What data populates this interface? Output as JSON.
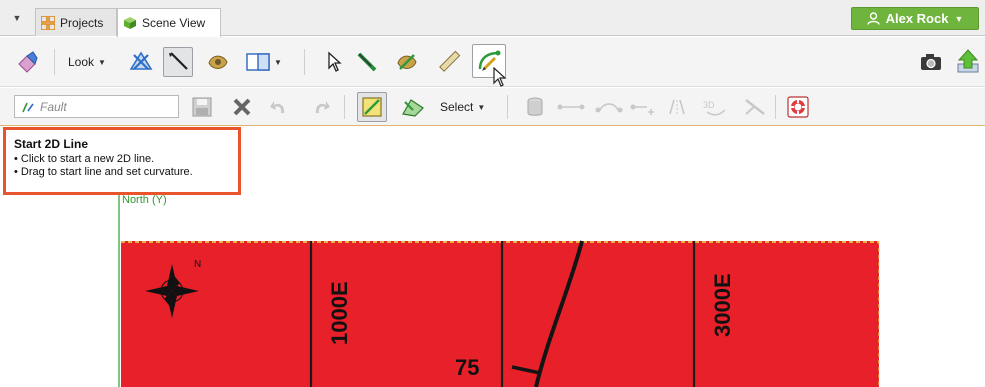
{
  "tabs": {
    "projects_label": "Projects",
    "scene_label": "Scene View"
  },
  "user": {
    "name": "Alex Rock"
  },
  "toolbar": {
    "look_label": "Look",
    "select_label": "Select"
  },
  "object_name_field": {
    "placeholder": "Fault"
  },
  "tooltip": {
    "title": "Start 2D Line",
    "lines": [
      "• Click to start a new 2D line.",
      "• Drag to start line and set curvature."
    ]
  },
  "scene": {
    "axis_label": "North (Y)",
    "map_labels": {
      "easting_1": "1000E",
      "easting_2": "3000E",
      "dip_value": "75",
      "compass_letter": "N"
    },
    "colors": {
      "map_fill": "#e8202a",
      "axis_green": "#2f9a2f",
      "tooltip_border": "#e8542b",
      "user_button": "#6fb43c"
    }
  }
}
